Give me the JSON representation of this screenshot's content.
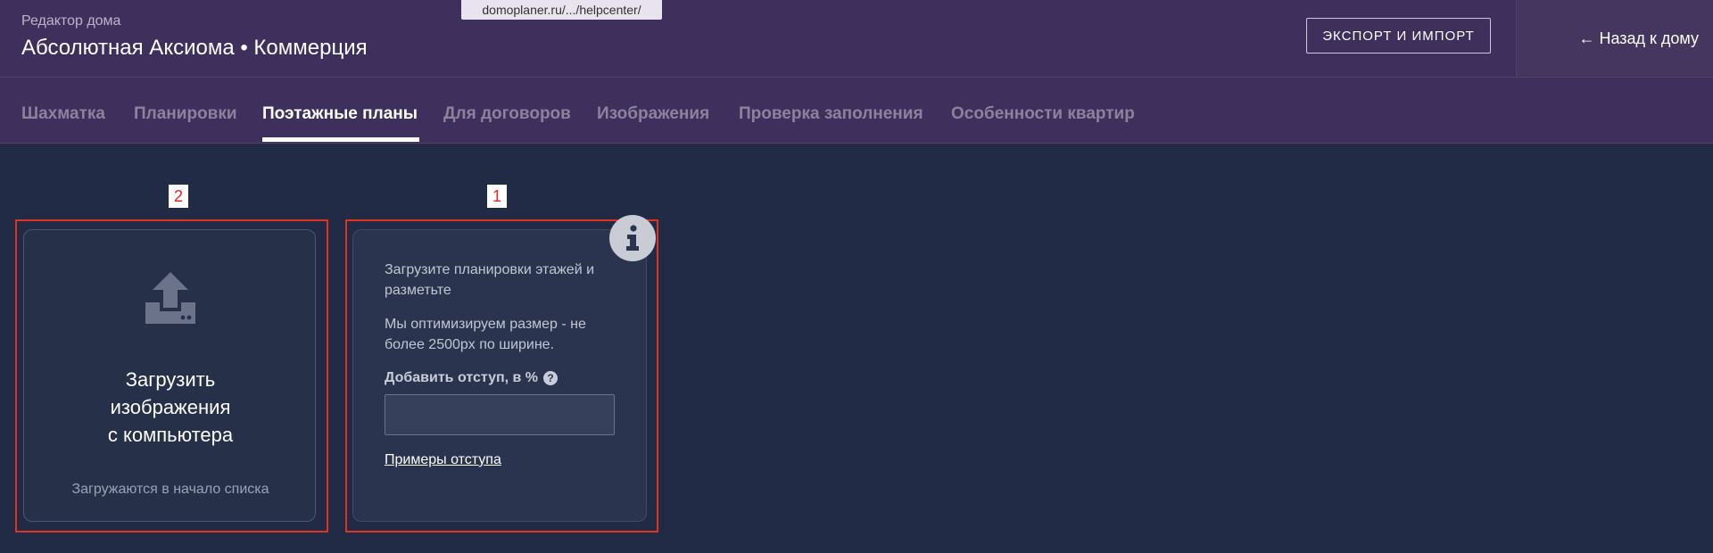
{
  "header": {
    "subtitle": "Редактор дома",
    "title": "Абсолютная Аксиома • Коммерция",
    "export_label": "Экспорт и импорт",
    "back_label": "← Назад к дому"
  },
  "url_tooltip": "domoplaner.ru/.../helpcenter/",
  "tabs": [
    {
      "label": "Шахматка"
    },
    {
      "label": "Планировки"
    },
    {
      "label": "Поэтажные планы",
      "active": true
    },
    {
      "label": "Для договоров"
    },
    {
      "label": "Изображения"
    },
    {
      "label": "Проверка заполнения"
    },
    {
      "label": "Особенности квартир"
    }
  ],
  "markers": {
    "upload": "2",
    "info": "1"
  },
  "upload_card": {
    "icon": "upload-icon",
    "title_line1": "Загрузить",
    "title_line2": "изображения",
    "title_line3": "с компьютера",
    "hint": "Загружаются в начало списка"
  },
  "info_card": {
    "icon": "info-icon",
    "text1": "Загрузите планировки этажей и разметьте",
    "text2": "Мы оптимизируем размер - не более 2500px по ширине.",
    "offset_label": "Добавить отступ, в %",
    "offset_value": "",
    "examples_link": "Примеры отступа"
  },
  "colors": {
    "header_bg": "#3e2f5c",
    "page_bg": "#222b45",
    "highlight_box": "#e03322"
  }
}
